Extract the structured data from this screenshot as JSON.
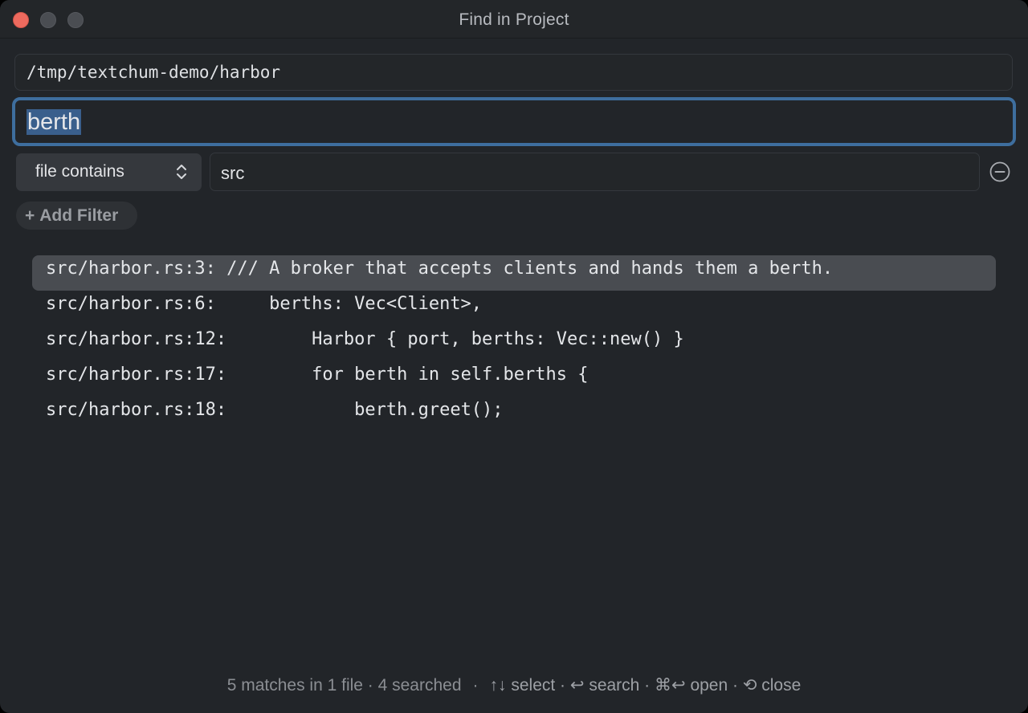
{
  "window": {
    "title": "Find in Project"
  },
  "project_path": "/tmp/textchum-demo/harbor",
  "query": {
    "value": "berth",
    "selected": true
  },
  "filter": {
    "type_label": "file contains",
    "value": "src",
    "add_label": "Add Filter"
  },
  "results": [
    {
      "ref": "src/harbor.rs:3:",
      "text": " /// A broker that accepts clients and hands them a berth.",
      "active": true
    },
    {
      "ref": "src/harbor.rs:6:",
      "text": "     berths: Vec<Client>,",
      "active": false
    },
    {
      "ref": "src/harbor.rs:12:",
      "text": "        Harbor { port, berths: Vec::new() }",
      "active": false
    },
    {
      "ref": "src/harbor.rs:17:",
      "text": "        for berth in self.berths {",
      "active": false
    },
    {
      "ref": "src/harbor.rs:18:",
      "text": "            berth.greet();",
      "active": false
    }
  ],
  "status": {
    "summary": "5 matches in 1 file · 4 searched",
    "separator": "·",
    "hints": "↑↓ select · ↩ search · ⌘↩ open · ⟲ close"
  },
  "colors": {
    "background": "#222529",
    "focus_border": "#3e6e9e",
    "selection": "#3a5f8c",
    "active_row": "#494c51",
    "close_button": "#ed6a5e"
  }
}
